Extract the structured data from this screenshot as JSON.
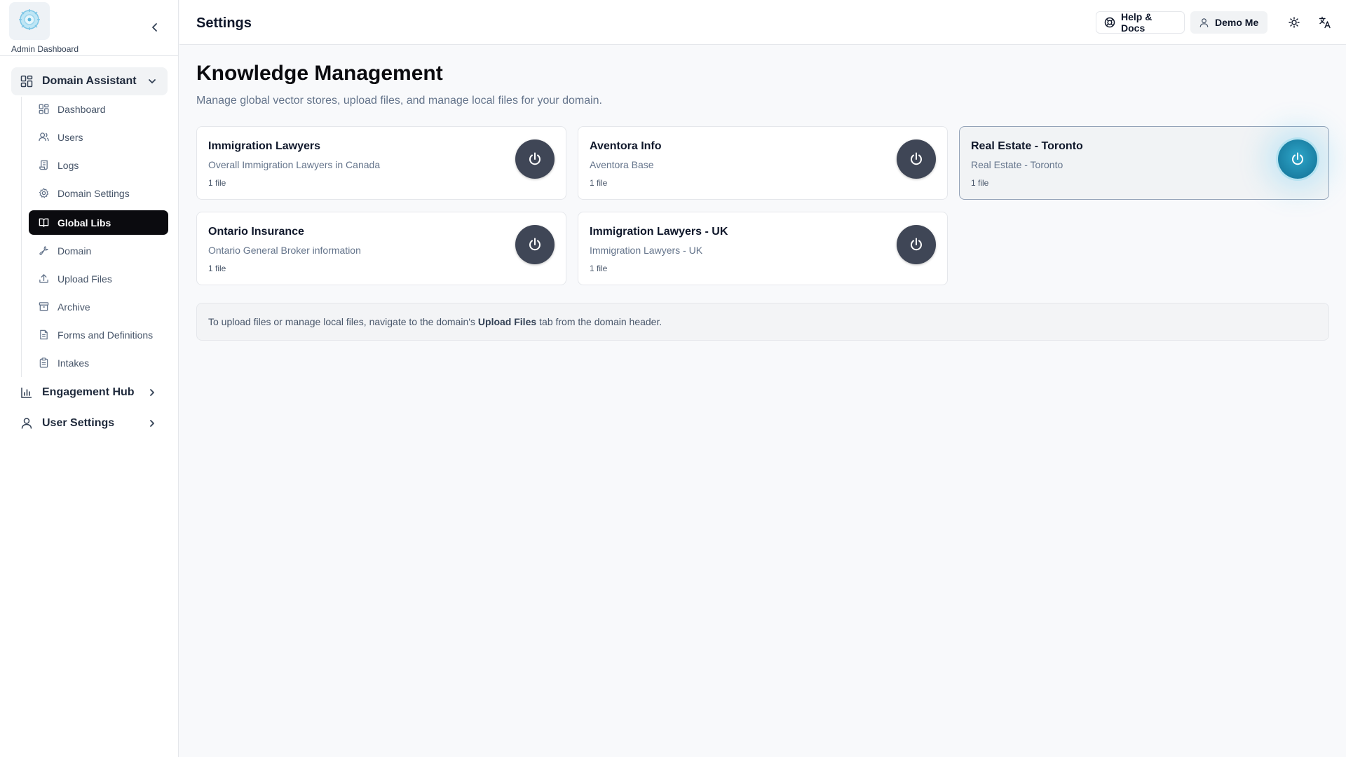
{
  "brand": {
    "label": "Admin Dashboard"
  },
  "sidebar": {
    "groups": [
      {
        "label": "Domain Assistant",
        "icon": "dashboard-grid-icon",
        "expanded": true
      },
      {
        "label": "Engagement Hub",
        "icon": "bar-chart-icon",
        "expanded": false
      },
      {
        "label": "User Settings",
        "icon": "user-icon",
        "expanded": false
      }
    ],
    "items": [
      {
        "label": "Dashboard",
        "icon": "dashboard-grid-icon"
      },
      {
        "label": "Users",
        "icon": "users-icon"
      },
      {
        "label": "Logs",
        "icon": "scroll-icon"
      },
      {
        "label": "Domain Settings",
        "icon": "gear-icon"
      },
      {
        "label": "Global Libs",
        "icon": "book-open-icon",
        "active": true
      },
      {
        "label": "Domain",
        "icon": "wrench-icon"
      },
      {
        "label": "Upload Files",
        "icon": "upload-icon"
      },
      {
        "label": "Archive",
        "icon": "archive-icon"
      },
      {
        "label": "Forms and Definitions",
        "icon": "file-text-icon"
      },
      {
        "label": "Intakes",
        "icon": "clipboard-icon"
      }
    ]
  },
  "header": {
    "title": "Settings",
    "help_label": "Help & Docs",
    "user_label": "Demo Me"
  },
  "main": {
    "heading": "Knowledge Management",
    "subtitle": "Manage global vector stores, upload files, and manage local files for your domain.",
    "cards": [
      {
        "title": "Immigration Lawyers",
        "description": "Overall Immigration Lawyers in Canada",
        "files": "1 file",
        "enabled": false
      },
      {
        "title": "Aventora Info",
        "description": "Aventora Base",
        "files": "1 file",
        "enabled": false
      },
      {
        "title": "Real Estate - Toronto",
        "description": "Real Estate - Toronto",
        "files": "1 file",
        "enabled": true
      },
      {
        "title": "Ontario Insurance",
        "description": "Ontario General Broker information",
        "files": "1 file",
        "enabled": false
      },
      {
        "title": "Immigration Lawyers - UK",
        "description": "Immigration Lawyers - UK",
        "files": "1 file",
        "enabled": false
      }
    ],
    "note": {
      "before": "To upload files or manage local files, navigate to the domain's",
      "emphasis": "Upload Files",
      "after": "tab from the domain header."
    }
  },
  "colors": {
    "active_nav": "#0b0b0f",
    "power_off": "#3f4656",
    "power_on": "#1a7fa3"
  }
}
